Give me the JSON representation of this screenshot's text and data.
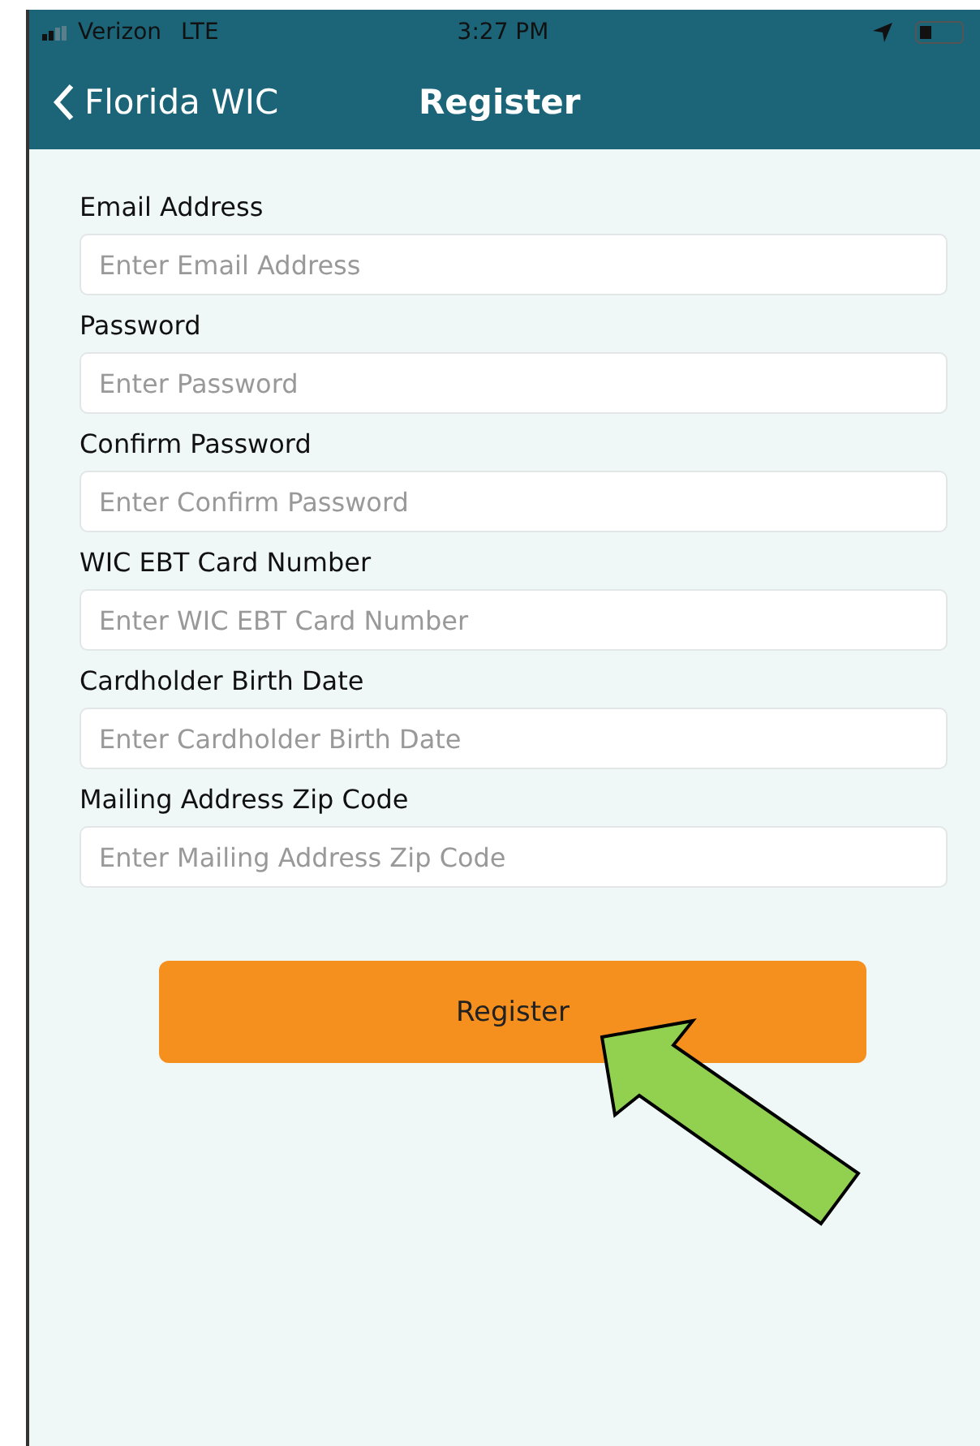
{
  "status_bar": {
    "carrier": "Verizon",
    "network": "LTE",
    "time": "3:27 PM"
  },
  "nav": {
    "back_label": "Florida WIC",
    "title": "Register"
  },
  "fields": [
    {
      "label": "Email Address",
      "placeholder": "Enter Email Address"
    },
    {
      "label": "Password",
      "placeholder": "Enter Password"
    },
    {
      "label": "Confirm Password",
      "placeholder": "Enter Confirm Password"
    },
    {
      "label": "WIC EBT Card Number",
      "placeholder": "Enter WIC EBT Card Number"
    },
    {
      "label": "Cardholder Birth Date",
      "placeholder": "Enter Cardholder Birth Date"
    },
    {
      "label": "Mailing Address Zip Code",
      "placeholder": "Enter Mailing Address Zip Code"
    }
  ],
  "register_button": "Register"
}
